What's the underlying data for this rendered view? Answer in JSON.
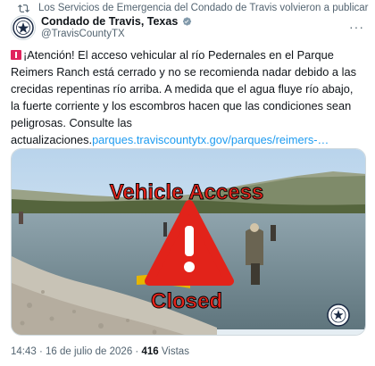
{
  "repost": {
    "text": "Los Servicios de Emergencia del Condado de Travis volvieron a publicar",
    "icon": "repost-icon"
  },
  "author": {
    "name": "Condado de Travis, Texas",
    "handle": "@TravisCountyTX",
    "verified_icon": "verified-badge-icon",
    "avatar_icon": "county-seal-icon"
  },
  "tweet": {
    "body": "¡Atención! El acceso vehicular al río Pedernales en el Parque Reimers Ranch está cerrado y no se recomienda nadar debido a las crecidas repentinas río arriba. A medida que el agua fluye río abajo, la fuerte corriente y los escombros hacen que las condiciones sean peligrosas. Consulte las actualizaciones.",
    "link": "parques.traviscountytx.gov/parques/reimers-…"
  },
  "media": {
    "overlay_top": "Vehicle Access",
    "overlay_bottom": "Closed",
    "warning_icon": "warning-icon",
    "watermark_icon": "county-seal-icon"
  },
  "meta": {
    "time": "14:43",
    "separator": " · ",
    "date": "16 de julio de 2026",
    "views_count": "416",
    "views_label": " Vistas"
  },
  "colors": {
    "accent": "#1d9bf0",
    "alert": "#e0245e",
    "warning": "#e2231a",
    "overlay_text": "#e2231a"
  }
}
